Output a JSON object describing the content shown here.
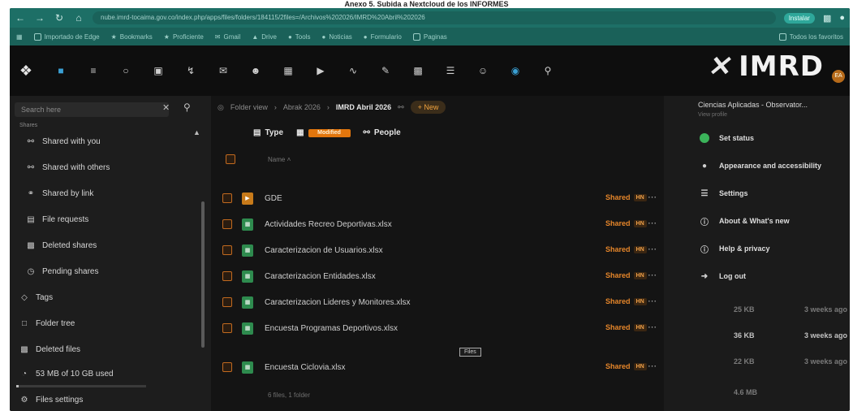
{
  "caption": "Anexo 5. Subida a Nextcloud de los INFORMES",
  "browser": {
    "url": "nube.imrd-tocaima.gov.co/index.php/apps/files/folders/184115/2files=/Archivos%202026/IMRD%20Abril%202026",
    "install_label": "Instalar",
    "bookmarks": [
      "Importado de Edge",
      "Bookmarks",
      "Proficiente",
      "Gmail",
      "Drive",
      "Tools",
      "Noticias",
      "Formulario",
      "Paginas"
    ],
    "all_bookmarks": "Todos los favoritos"
  },
  "header": {
    "brand": "IMRD",
    "avatar_initials": "EA",
    "icons": [
      "files-icon",
      "activity-icon",
      "circle-icon",
      "photos-icon",
      "lightning-icon",
      "mail-icon",
      "contacts-icon",
      "calendar-icon",
      "announce-icon",
      "notes-icon",
      "pen-icon",
      "print-icon",
      "list-icon",
      "profile-icon",
      "globe-icon",
      "search-icon"
    ]
  },
  "sidebar": {
    "search_placeholder": "Search here",
    "section_label": "Shares",
    "items": [
      {
        "icon": "share-user-icon",
        "label": "Shared with you"
      },
      {
        "icon": "share-others-icon",
        "label": "Shared with others"
      },
      {
        "icon": "link-icon",
        "label": "Shared by link"
      },
      {
        "icon": "file-request-icon",
        "label": "File requests"
      },
      {
        "icon": "trash-icon",
        "label": "Deleted shares"
      },
      {
        "icon": "pending-icon",
        "label": "Pending shares"
      }
    ],
    "bottom": [
      {
        "icon": "tag-icon",
        "label": "Tags"
      },
      {
        "icon": "folder-tree-icon",
        "label": "Folder tree"
      },
      {
        "icon": "trash-icon",
        "label": "Deleted files"
      },
      {
        "icon": "quota-icon",
        "label": "53 MB of 10 GB used"
      },
      {
        "icon": "gear-icon",
        "label": "Files settings"
      }
    ],
    "quota_fraction": 0.005
  },
  "main": {
    "breadcrumbs": [
      "Folder view",
      "Abrak 2026"
    ],
    "current_folder": "IMRD Abril 2026",
    "new_label": "New",
    "filters": {
      "type": "Type",
      "modified": "Modified",
      "people": "People"
    },
    "column_name": "Name",
    "files": [
      {
        "kind": "folder",
        "name": "GDE",
        "share": "Shared",
        "owner": "HN"
      },
      {
        "kind": "xls",
        "name": "Actividades Recreo Deportivas.xlsx",
        "share": "Shared",
        "owner": "HN"
      },
      {
        "kind": "xls",
        "name": "Caracterizacion de Usuarios.xlsx",
        "share": "Shared",
        "owner": "HN"
      },
      {
        "kind": "xls",
        "name": "Caracterizacion Entidades.xlsx",
        "share": "Shared",
        "owner": "HN"
      },
      {
        "kind": "xls",
        "name": "Caracterizacion Lideres y Monitores.xlsx",
        "share": "Shared",
        "owner": "HN"
      },
      {
        "kind": "xls",
        "name": "Encuesta Programas Deportivos.xlsx",
        "share": "Shared",
        "owner": "HN"
      },
      {
        "kind": "xls",
        "name": "Encuesta Ciclovia.xlsx",
        "share": "Shared",
        "owner": "HN"
      }
    ],
    "tooltip": "Files",
    "summary": "6 files, 1 folder"
  },
  "menu": {
    "user": "Ciencias Aplicadas - Observator...",
    "view_profile": "View profile",
    "items": [
      {
        "icon": "status-icon",
        "label": "Set status"
      },
      {
        "icon": "accessibility-icon",
        "label": "Appearance and accessibility"
      },
      {
        "icon": "gear-icon",
        "label": "Settings"
      },
      {
        "icon": "info-icon",
        "label": "About & What's new"
      },
      {
        "icon": "help-icon",
        "label": "Help & privacy"
      },
      {
        "icon": "logout-icon",
        "label": "Log out"
      }
    ],
    "sizes": [
      {
        "size": "25 KB",
        "modified": "3 weeks ago"
      },
      {
        "size": "36 KB",
        "modified": "3 weeks ago"
      },
      {
        "size": "22 KB",
        "modified": "3 weeks ago"
      },
      {
        "size": "4.6 MB",
        "modified": ""
      }
    ]
  }
}
